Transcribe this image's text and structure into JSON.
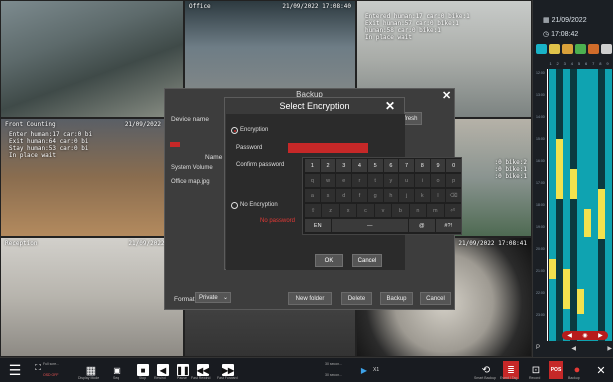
{
  "cameras": [
    {
      "id": "cam1",
      "date": "",
      "lines": ""
    },
    {
      "id": "cam2",
      "name": "Office",
      "date": "21/09/2022 17:08:40",
      "lines": ""
    },
    {
      "id": "cam3",
      "date": "",
      "lines": "Entered human:17 car:0 bike:1\nExit human:57 car:0 bike:1\nhuman:58 car:0 bike:1\nIn place wait"
    },
    {
      "id": "cam4",
      "name": "Front Counting",
      "date": "21/09/2022 17:0",
      "lines": "Enter human:17 car:0 bi\nExit human:64 car:0 bi\nStay human:53 car:0 bi\nIn place wait"
    },
    {
      "id": "cam5",
      "date": "",
      "lines": ""
    },
    {
      "id": "cam6",
      "date": "",
      "lines": ":0 bike:2\n:0 bike:1\n:0 bike:1"
    },
    {
      "id": "cam7",
      "name": "Reception",
      "date": "21/09/2022 17:",
      "lines": ""
    },
    {
      "id": "cam8",
      "date": "",
      "lines": ""
    },
    {
      "id": "cam9",
      "date": "21/09/2022 17:08:41",
      "lines": ""
    }
  ],
  "right_panel": {
    "date": "21/09/2022",
    "time": "17:08:42",
    "channels": [
      "1",
      "2",
      "3",
      "4",
      "5",
      "6",
      "7",
      "8",
      "9"
    ],
    "time_rows": [
      "12:00",
      "13:00",
      "14:00",
      "15:00",
      "16:00",
      "17:00",
      "18:00",
      "19:00",
      "20:00",
      "21:00",
      "22:00",
      "23:00"
    ],
    "bottom_left": "P",
    "bottom_mid": "◀",
    "bottom_right": "▶"
  },
  "backup": {
    "title": "Backup",
    "device_label": "Device name",
    "refresh_label": "Refresh",
    "name_header": "Name",
    "system_volume": "System Volume",
    "file": "Office map.jpg",
    "format_label": "Format",
    "format_value": "Private",
    "new_folder": "New folder",
    "delete": "Delete",
    "backup_btn": "Backup",
    "cancel": "Cancel"
  },
  "encryption": {
    "title": "Select Encryption",
    "encryption_label": "Encryption",
    "password_label": "Password",
    "confirm_label": "Confirm password",
    "no_encryption_label": "No Encryption",
    "no_password_text": "No password",
    "ok": "OK",
    "cancel": "Cancel"
  },
  "keyboard": {
    "row1": [
      "1",
      "2",
      "3",
      "4",
      "5",
      "6",
      "7",
      "8",
      "9",
      "0"
    ],
    "row2": [
      "q",
      "w",
      "e",
      "r",
      "t",
      "y",
      "u",
      "i",
      "o",
      "p"
    ],
    "row3": [
      "a",
      "s",
      "d",
      "f",
      "g",
      "h",
      "j",
      "k",
      "l",
      "⌫"
    ],
    "row4": [
      "⇧",
      "z",
      "x",
      "c",
      "v",
      "b",
      "n",
      "m",
      "⏎"
    ],
    "row5": [
      "EN",
      "—",
      "@",
      "#?!"
    ]
  },
  "toolbar": {
    "full_screen": "Full scre...",
    "osd_off": "OSD OFF",
    "display_mode": "Display Mode",
    "seq": "Seq",
    "stop": "Stop",
    "rewind": "Rewind",
    "pause": "Pause",
    "fast_rewind": "Fast Rewind",
    "fast_forward": "Fast Forward",
    "speed_left": "30 secon...",
    "speed_right": "30 secon...",
    "speed": "X1",
    "smart_backup": "Smart Backup",
    "event_tag": "Event / Tag",
    "record": "Record",
    "pos_label": "POS",
    "backup_label": "Backup",
    "close": "✕"
  },
  "colors": {
    "accent_red": "#c62828",
    "timeline_cyan": "#0fa3b1",
    "timeline_yellow": "#f2e24e"
  }
}
